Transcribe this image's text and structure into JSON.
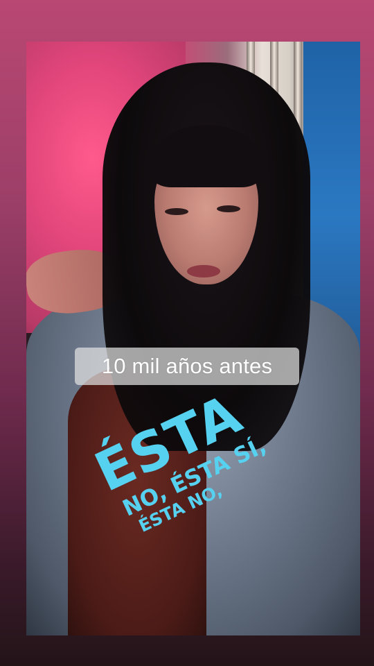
{
  "story": {
    "caption": "10 mil años antes",
    "sticker": {
      "big": "ÉSTA",
      "line2": "NO, ÉSTA SÍ,",
      "line3": "ÉSTA NO,",
      "color": "#57d1f0"
    }
  }
}
